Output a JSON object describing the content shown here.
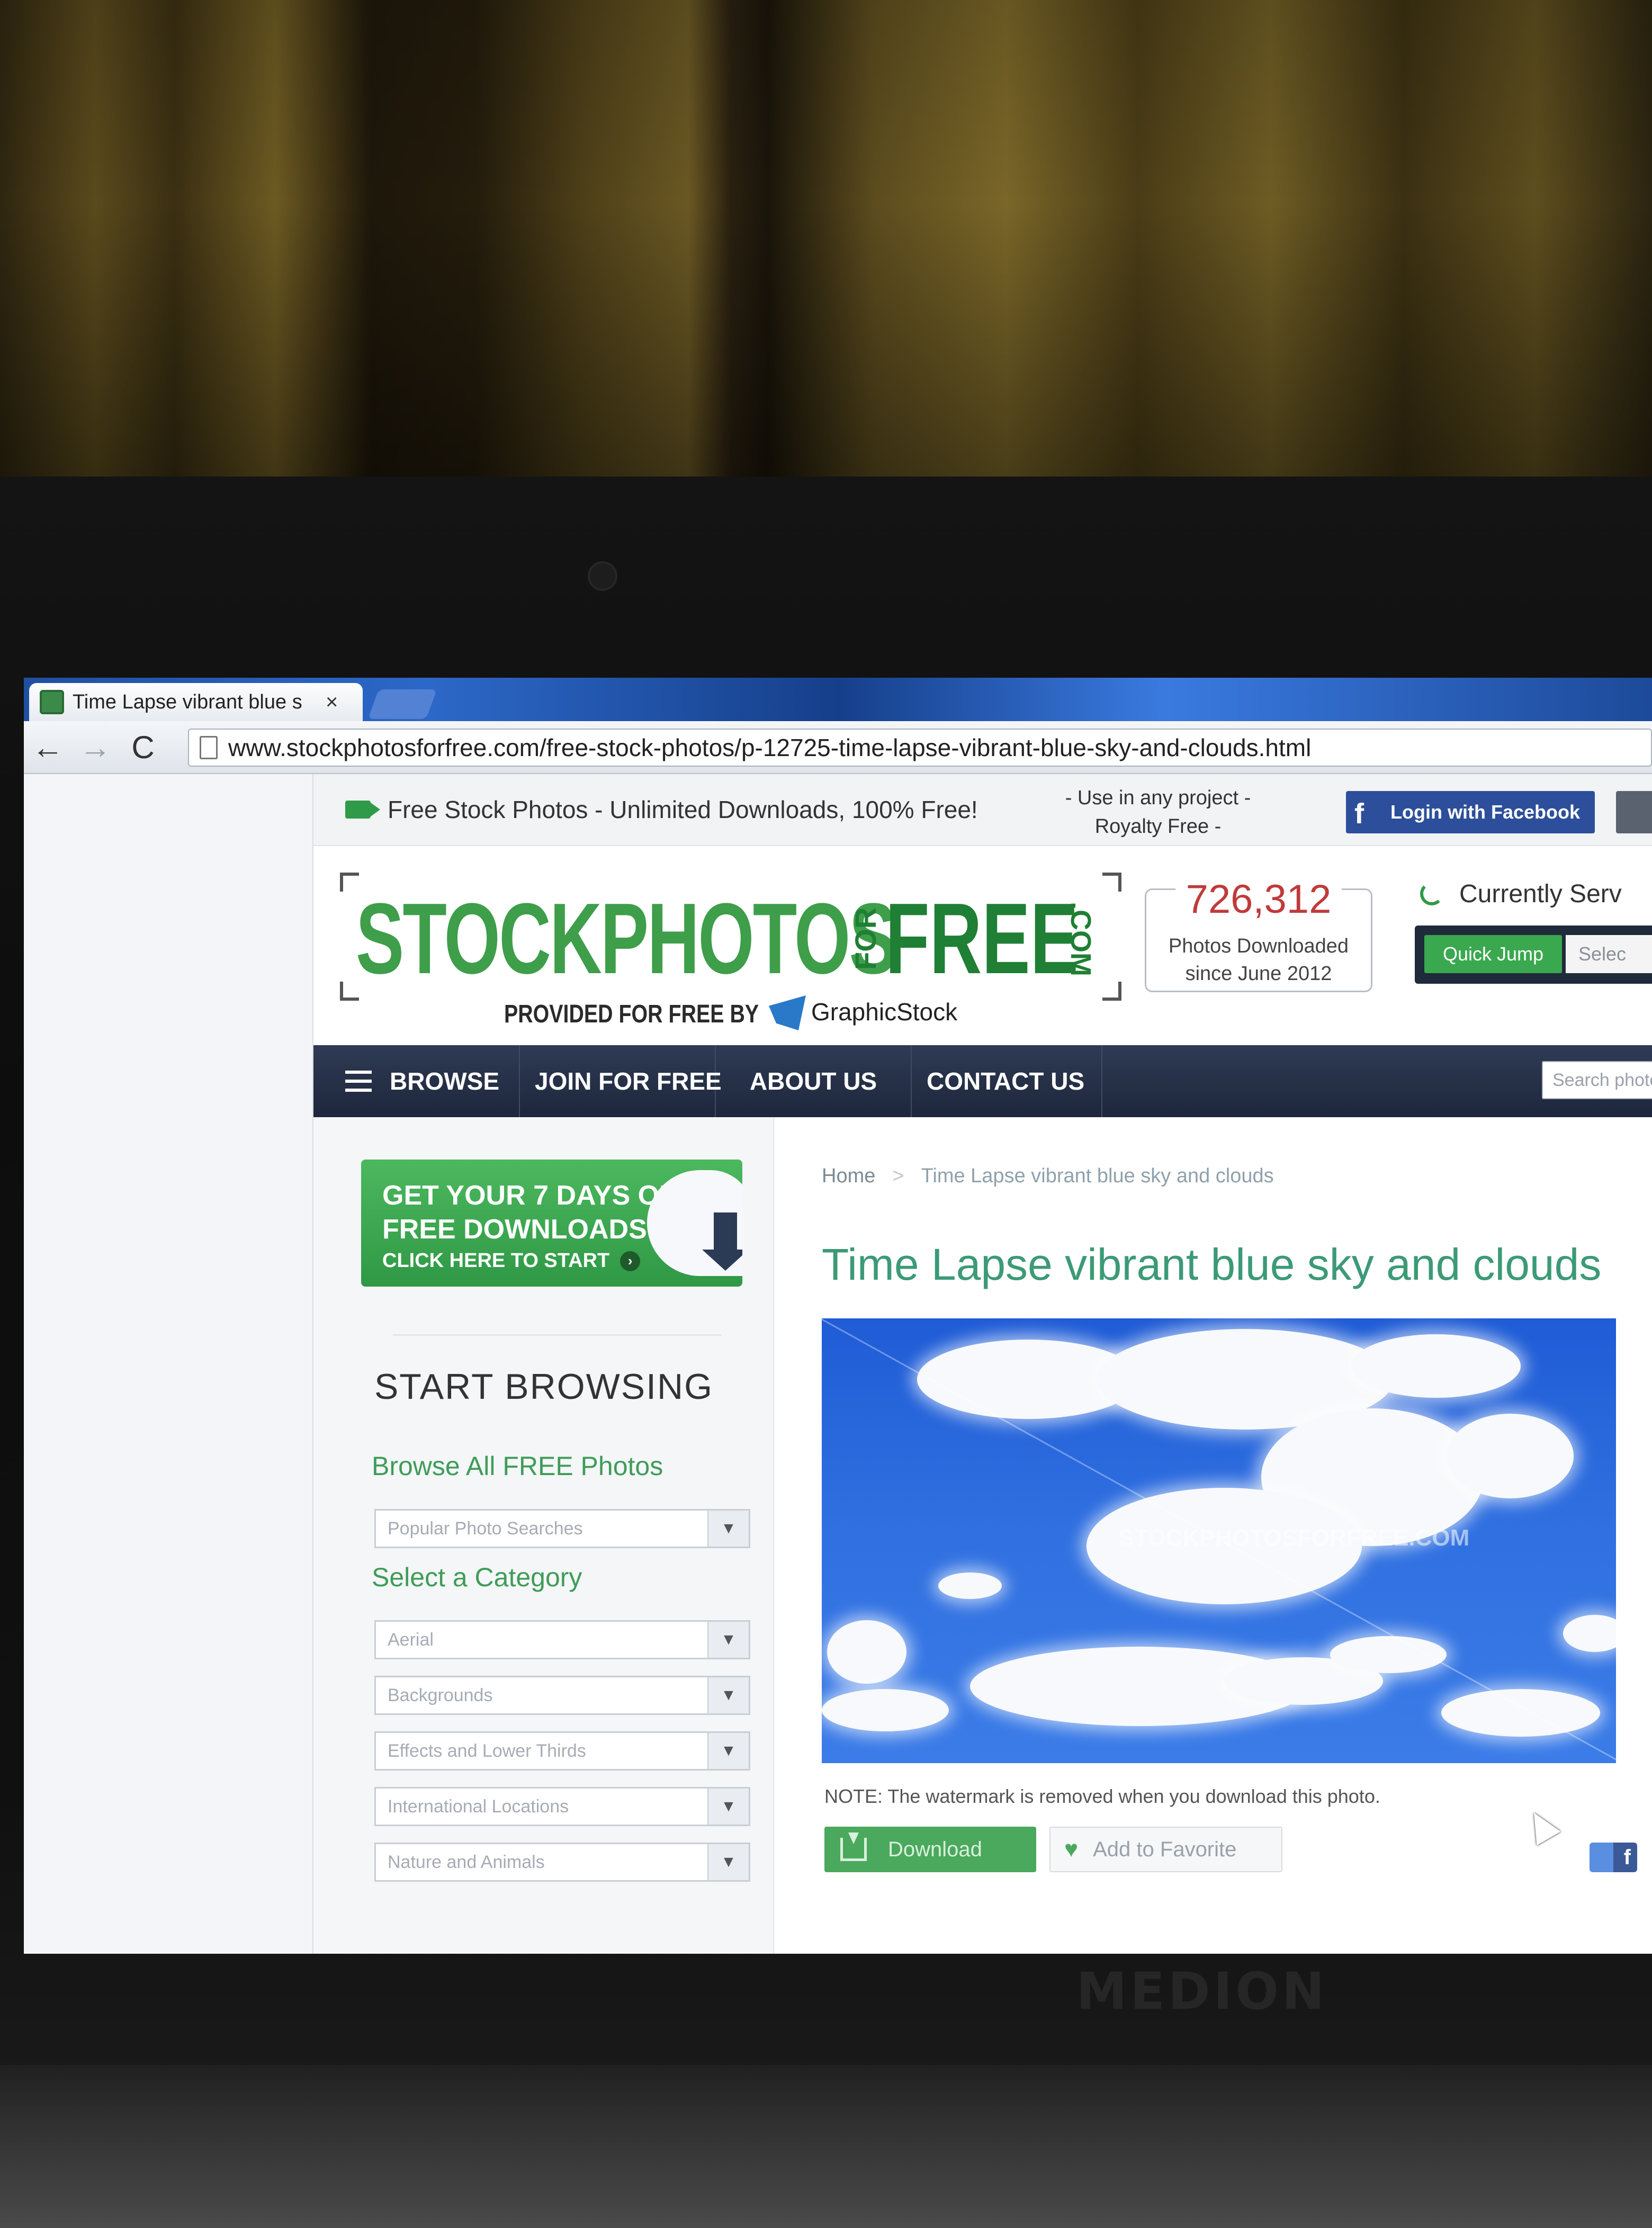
{
  "browser": {
    "tab_title": "Time Lapse vibrant blue s",
    "tab_close": "×",
    "back": "←",
    "forward": "→",
    "reload": "C",
    "url": "www.stockphotosforfree.com/free-stock-photos/p-12725-time-lapse-vibrant-blue-sky-and-clouds.html"
  },
  "top_bar": {
    "tagline": "Free Stock Photos - Unlimited Downloads, 100% Free!",
    "use_note_line1": "- Use in any project -",
    "use_note_line2": "Royalty Free -",
    "facebook_icon_glyph": "f",
    "facebook_login": "Login with Facebook"
  },
  "header": {
    "logo_main": "STOCKPHOTOS",
    "logo_for": "FOR",
    "logo_free": "FREE",
    "logo_com": ".COM",
    "provided_by": "PROVIDED FOR FREE BY",
    "provider_name": "GraphicStock",
    "counter_value": "726,312",
    "counter_label_line1": "Photos Downloaded",
    "counter_label_line2": "since June 2012",
    "serving_text": "Currently Serv",
    "quick_jump": "Quick Jump",
    "quick_jump_select": "Selec"
  },
  "nav": {
    "browse": "BROWSE",
    "join": "JOIN FOR FREE",
    "about": "ABOUT US",
    "contact": "CONTACT US",
    "search_placeholder": "Search photo"
  },
  "sidebar": {
    "promo_line1": "GET YOUR 7 DAYS OF",
    "promo_line2": "FREE DOWNLOADS",
    "promo_cta": "CLICK HERE TO START",
    "promo_arrow_glyph": "›",
    "start_browsing": "START BROWSING",
    "browse_all": "Browse All FREE Photos",
    "popular_searches": "Popular Photo Searches",
    "select_category": "Select a Category",
    "dropdown_arrow": "▼",
    "categories": [
      "Aerial",
      "Backgrounds",
      "Effects and Lower Thirds",
      "International Locations",
      "Nature and Animals"
    ]
  },
  "main": {
    "breadcrumb_home": "Home",
    "breadcrumb_sep": ">",
    "breadcrumb_current": "Time Lapse vibrant blue sky and clouds",
    "title": "Time Lapse vibrant blue sky and clouds",
    "watermark": "STOCKPHOTOSFORFREE.COM",
    "note": "NOTE: The watermark is removed when you download this photo.",
    "download": "Download",
    "heart_glyph": "♥",
    "favorite": "Add to Favorite",
    "share_glyph": "f"
  },
  "laptop_brand": "MEDION",
  "colors": {
    "brand_green": "#3e9e4a",
    "nav_dark": "#1d263b",
    "counter_red": "#c03a3a",
    "facebook_blue": "#2d4f9b",
    "sky_blue": "#2f6fe0"
  }
}
